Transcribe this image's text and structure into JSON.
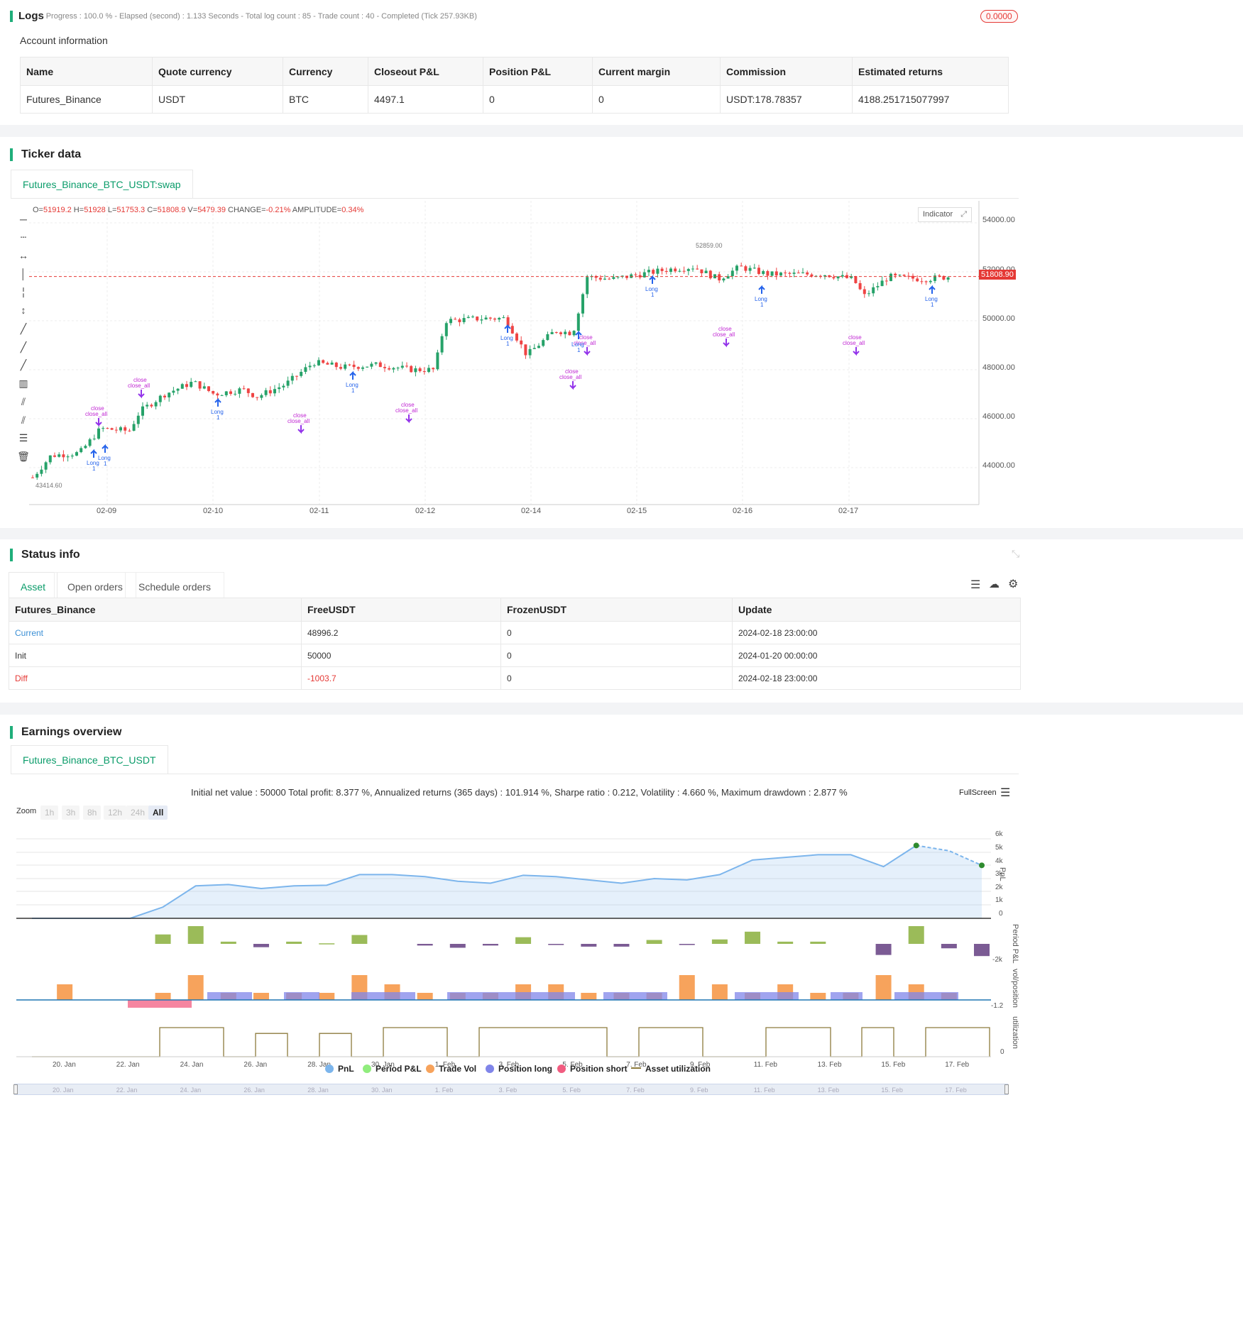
{
  "logs": {
    "title": "Logs",
    "meta": "- Progress : 100.0 % - Elapsed (second) : 1.133  Seconds - Total log count : 85 - Trade count : 40 - Completed (Tick 257.93KB)",
    "badge": "0.0000",
    "account_title": "Account information",
    "columns": [
      "Name",
      "Quote currency",
      "Currency",
      "Closeout P&L",
      "Position P&L",
      "Current margin",
      "Commission",
      "Estimated returns"
    ],
    "row": [
      "Futures_Binance",
      "USDT",
      "BTC",
      "4497.1",
      "0",
      "0",
      "USDT:178.78357",
      "4188.251715077997"
    ]
  },
  "ticker": {
    "title": "Ticker data",
    "tab": "Futures_Binance_BTC_USDT:swap",
    "ohlc": {
      "o_label": "O=",
      "o": "51919.2",
      "h_label": " H=",
      "h": "51928",
      "l_label": " L=",
      "l": "51753.3",
      "c_label": " C=",
      "c": "51808.9",
      "v_label": " V=",
      "v": "5479.39",
      "chg_label": " CHANGE=",
      "chg": "-0.21%",
      "amp_label": " AMPLITUDE=",
      "amp": "0.34%"
    },
    "indicator_btn": "Indicator",
    "price_ticks": [
      "54000.00",
      "52000.00",
      "50000.00",
      "48000.00",
      "46000.00",
      "44000.00"
    ],
    "last_price": "51808.90",
    "high_mark": "52859.00",
    "low_mark": "43414.60",
    "date_ticks": [
      "02-09",
      "02-10",
      "02-11",
      "02-12",
      "02-14",
      "02-15",
      "02-16",
      "02-17"
    ],
    "marker_close": "close",
    "marker_close_all": "close_all",
    "marker_long": "Long",
    "marker_one": "1",
    "tool_icons": [
      "horizontal-line-icon",
      "horizontal-ray-icon",
      "horizontal-segment-icon",
      "vertical-line-icon",
      "vertical-ray-icon",
      "vertical-segment-icon",
      "trend-line-icon",
      "ray-icon",
      "segment-icon",
      "price-range-icon",
      "parallel-channel-icon",
      "fib-channel-icon",
      "fib-retracement-icon",
      "trash-icon"
    ]
  },
  "status": {
    "title": "Status info",
    "tabs": [
      "Asset",
      "Open orders",
      "Schedule orders"
    ],
    "columns": [
      "Futures_Binance",
      "FreeUSDT",
      "FrozenUSDT",
      "Update"
    ],
    "rows": [
      [
        "Current",
        "48996.2",
        "0",
        "2024-02-18 23:00:00"
      ],
      [
        "Init",
        "50000",
        "0",
        "2024-01-20 00:00:00"
      ],
      [
        "Diff",
        "-1003.7",
        "0",
        "2024-02-18 23:00:00"
      ]
    ]
  },
  "earnings": {
    "title": "Earnings overview",
    "tab": "Futures_Binance_BTC_USDT",
    "summary": "Initial net value : 50000 Total profit: 8.377 %, Annualized returns (365 days) : 101.914 %, Sharpe ratio : 0.212, Volatility : 4.660 %, Maximum drawdown : 2.877 %",
    "fullscreen": "FullScreen",
    "zoom_label": "Zoom",
    "zoom_options": [
      "1h",
      "3h",
      "8h",
      "12h",
      "24h",
      "All"
    ],
    "pnl_ticks": [
      "6k",
      "5k",
      "4k",
      "3k",
      "2k",
      "1k",
      "0"
    ],
    "period_tick": "-2k",
    "vol_tick": "-1.2",
    "util_tick": "0",
    "axis_titles": [
      "PnL",
      "Period P&L",
      "vol/position",
      "utilization"
    ],
    "date_ticks": [
      "20. Jan",
      "22. Jan",
      "24. Jan",
      "26. Jan",
      "28. Jan",
      "30. Jan",
      "1. Feb",
      "3. Feb",
      "5. Feb",
      "7. Feb",
      "9. Feb",
      "11. Feb",
      "13. Feb",
      "15. Feb",
      "17. Feb"
    ],
    "legend": [
      {
        "label": "PnL",
        "color": "#7cb5ec"
      },
      {
        "label": "Period P&L",
        "color": "#90ed7d"
      },
      {
        "label": "Trade Vol",
        "color": "#f7a35c"
      },
      {
        "label": "Position long",
        "color": "#8085e9"
      },
      {
        "label": "Position short",
        "color": "#f15c80"
      },
      {
        "label": "Asset utilization",
        "color": "#8d7b3c"
      }
    ]
  },
  "chart_data": [
    {
      "type": "line",
      "title": "",
      "ylabel": "PnL",
      "x": [
        "20. Jan",
        "21. Jan",
        "22. Jan",
        "23. Jan",
        "24. Jan",
        "25. Jan",
        "26. Jan",
        "27. Jan",
        "28. Jan",
        "29. Jan",
        "30. Jan",
        "31. Jan",
        "1. Feb",
        "2. Feb",
        "3. Feb",
        "4. Feb",
        "5. Feb",
        "6. Feb",
        "7. Feb",
        "8. Feb",
        "9. Feb",
        "10. Feb",
        "11. Feb",
        "12. Feb",
        "13. Feb",
        "14. Feb",
        "15. Feb",
        "16. Feb",
        "17. Feb",
        "18. Feb"
      ],
      "values": [
        0,
        0,
        0,
        0,
        850,
        2450,
        2550,
        2250,
        2450,
        2500,
        3300,
        3300,
        3150,
        2800,
        2650,
        3250,
        3150,
        2900,
        2650,
        3000,
        2900,
        3300,
        4400,
        4600,
        4800,
        4800,
        3900,
        5500,
        5100,
        4000
      ],
      "ylim": [
        0,
        6000
      ]
    },
    {
      "type": "bar",
      "title": "",
      "ylabel": "Period P&L",
      "categories": [
        "20. Jan",
        "21. Jan",
        "22. Jan",
        "23. Jan",
        "24. Jan",
        "25. Jan",
        "26. Jan",
        "27. Jan",
        "28. Jan",
        "29. Jan",
        "30. Jan",
        "31. Jan",
        "1. Feb",
        "2. Feb",
        "3. Feb",
        "4. Feb",
        "5. Feb",
        "6. Feb",
        "7. Feb",
        "8. Feb",
        "9. Feb",
        "10. Feb",
        "11. Feb",
        "12. Feb",
        "13. Feb",
        "14. Feb",
        "15. Feb",
        "16. Feb",
        "17. Feb",
        "18. Feb"
      ],
      "values": [
        0,
        0,
        0,
        0,
        850,
        1600,
        200,
        -300,
        200,
        50,
        800,
        0,
        -150,
        -350,
        -150,
        600,
        -100,
        -250,
        -250,
        350,
        -100,
        400,
        1100,
        200,
        200,
        0,
        -1000,
        1600,
        -400,
        -1100
      ]
    }
  ]
}
